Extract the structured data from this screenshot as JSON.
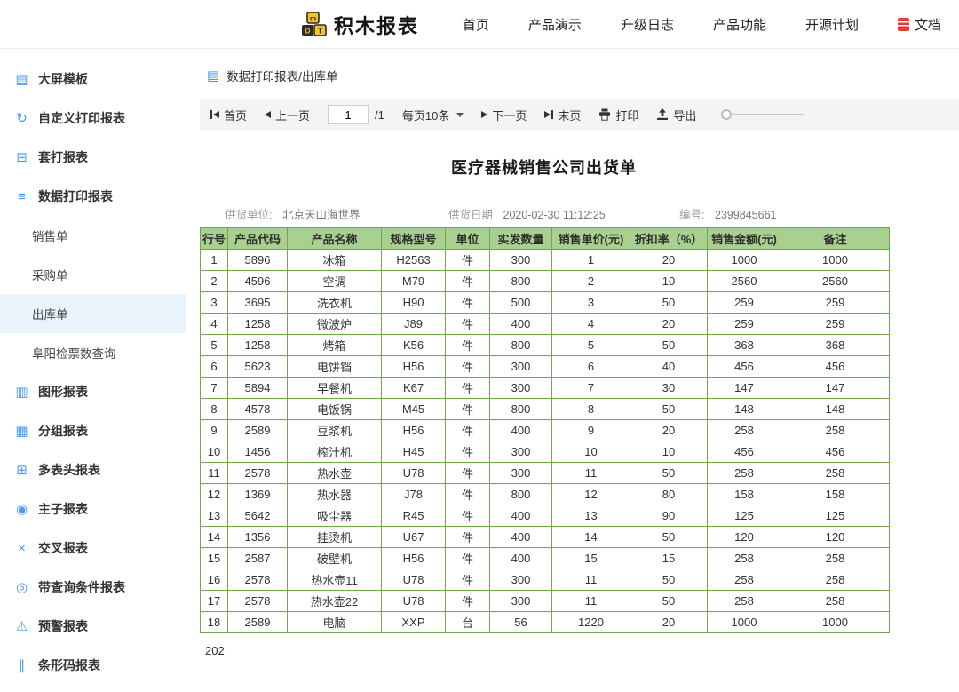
{
  "navbar": {
    "logo_text": "积木报表",
    "items": [
      {
        "id": "home",
        "label": "首页"
      },
      {
        "id": "product-demo",
        "label": "产品演示"
      },
      {
        "id": "changelog",
        "label": "升级日志"
      },
      {
        "id": "product-features",
        "label": "产品功能"
      },
      {
        "id": "open-source-plan",
        "label": "开源计划"
      },
      {
        "id": "docs",
        "label": "文档",
        "icon": "docs-icon"
      }
    ]
  },
  "sidebar": {
    "items": [
      {
        "id": "big-screen-template",
        "label": "大屏模板",
        "icon": "screen-icon",
        "glyph": "▤"
      },
      {
        "id": "custom-print-report",
        "label": "自定义打印报表",
        "icon": "custom-print-icon",
        "glyph": "↻"
      },
      {
        "id": "overlay-print-report",
        "label": "套打报表",
        "icon": "overlay-print-icon",
        "glyph": "⊟"
      },
      {
        "id": "data-print-report",
        "label": "数据打印报表",
        "icon": "data-print-icon",
        "glyph": "≡"
      },
      {
        "id": "sales-order",
        "label": "销售单",
        "child": true
      },
      {
        "id": "purchase-order",
        "label": "采购单",
        "child": true
      },
      {
        "id": "outbound-order",
        "label": "出库单",
        "child": true,
        "selected": true
      },
      {
        "id": "fuyang-ticket-query",
        "label": "阜阳检票数查询",
        "child": true
      },
      {
        "id": "chart-report",
        "label": "图形报表",
        "icon": "bar-chart-icon",
        "glyph": "▥"
      },
      {
        "id": "group-report",
        "label": "分组报表",
        "icon": "group-report-icon",
        "glyph": "▦"
      },
      {
        "id": "multi-header-report",
        "label": "多表头报表",
        "icon": "multi-header-icon",
        "glyph": "⊞"
      },
      {
        "id": "master-detail-report",
        "label": "主子报表",
        "icon": "master-detail-icon",
        "glyph": "◉"
      },
      {
        "id": "cross-report",
        "label": "交叉报表",
        "icon": "cross-report-icon",
        "glyph": "×"
      },
      {
        "id": "query-condition-report",
        "label": "带查询条件报表",
        "icon": "query-icon",
        "glyph": "◎"
      },
      {
        "id": "warning-report",
        "label": "预警报表",
        "icon": "warning-icon",
        "glyph": "⚠"
      },
      {
        "id": "barcode-report",
        "label": "条形码报表",
        "icon": "barcode-icon",
        "glyph": "∥"
      }
    ]
  },
  "breadcrumb": {
    "icon": "report-stack-icon",
    "text": "数据打印报表/出库单"
  },
  "toolbar": {
    "first": "首页",
    "prev": "上一页",
    "page_value": "1",
    "page_total": "/1",
    "page_size": "每页10条",
    "next": "下一页",
    "last": "末页",
    "print": "打印",
    "export": "导出"
  },
  "report": {
    "title": "医疗器械销售公司出货单",
    "supplier_label": "供货单位:",
    "supplier_value": "北京天山海世界",
    "date_label": "供货日期",
    "date_value": "2020-02-30 11:12:25",
    "number_label": "编号:",
    "number_value": "2399845661",
    "footer_text": "202"
  },
  "table": {
    "headers": [
      "行号",
      "产品代码",
      "产品名称",
      "规格型号",
      "单位",
      "实发数量",
      "销售单价(元)",
      "折扣率（%）",
      "销售金额(元)",
      "备注"
    ],
    "rows": [
      [
        "1",
        "5896",
        "冰箱",
        "H2563",
        "件",
        "300",
        "1",
        "20",
        "1000",
        "1000"
      ],
      [
        "2",
        "4596",
        "空调",
        "M79",
        "件",
        "800",
        "2",
        "10",
        "2560",
        "2560"
      ],
      [
        "3",
        "3695",
        "洗衣机",
        "H90",
        "件",
        "500",
        "3",
        "50",
        "259",
        "259"
      ],
      [
        "4",
        "1258",
        "微波炉",
        "J89",
        "件",
        "400",
        "4",
        "20",
        "259",
        "259"
      ],
      [
        "5",
        "1258",
        "烤箱",
        "K56",
        "件",
        "800",
        "5",
        "50",
        "368",
        "368"
      ],
      [
        "6",
        "5623",
        "电饼铛",
        "H56",
        "件",
        "300",
        "6",
        "40",
        "456",
        "456"
      ],
      [
        "7",
        "5894",
        "早餐机",
        "K67",
        "件",
        "300",
        "7",
        "30",
        "147",
        "147"
      ],
      [
        "8",
        "4578",
        "电饭锅",
        "M45",
        "件",
        "800",
        "8",
        "50",
        "148",
        "148"
      ],
      [
        "9",
        "2589",
        "豆浆机",
        "H56",
        "件",
        "400",
        "9",
        "20",
        "258",
        "258"
      ],
      [
        "10",
        "1456",
        "榨汁机",
        "H45",
        "件",
        "300",
        "10",
        "10",
        "456",
        "456"
      ],
      [
        "11",
        "2578",
        "热水壶",
        "U78",
        "件",
        "300",
        "11",
        "50",
        "258",
        "258"
      ],
      [
        "12",
        "1369",
        "热水器",
        "J78",
        "件",
        "800",
        "12",
        "80",
        "158",
        "158"
      ],
      [
        "13",
        "5642",
        "吸尘器",
        "R45",
        "件",
        "400",
        "13",
        "90",
        "125",
        "125"
      ],
      [
        "14",
        "1356",
        "挂烫机",
        "U67",
        "件",
        "400",
        "14",
        "50",
        "120",
        "120"
      ],
      [
        "15",
        "2587",
        "破壁机",
        "H56",
        "件",
        "400",
        "15",
        "15",
        "258",
        "258"
      ],
      [
        "16",
        "2578",
        "热水壶11",
        "U78",
        "件",
        "300",
        "11",
        "50",
        "258",
        "258"
      ],
      [
        "17",
        "2578",
        "热水壶22",
        "U78",
        "件",
        "300",
        "11",
        "50",
        "258",
        "258"
      ],
      [
        "18",
        "2589",
        "电脑",
        "XXP",
        "台",
        "56",
        "1220",
        "20",
        "1000",
        "1000"
      ]
    ]
  },
  "colors": {
    "accent_blue": "#1890ff",
    "table_header_green": "#a9d08e",
    "table_border_green": "#6fa84f",
    "selected_item_bg": "#e8f3fc",
    "docs_icon_red": "#e23c39"
  }
}
